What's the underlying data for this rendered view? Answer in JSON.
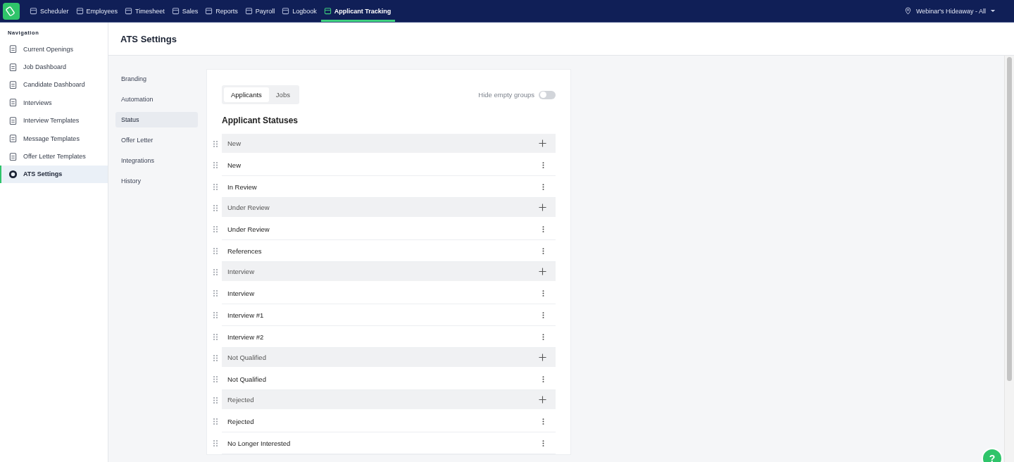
{
  "topbar": {
    "nav": [
      {
        "label": "Scheduler",
        "selected": false
      },
      {
        "label": "Employees",
        "selected": false
      },
      {
        "label": "Timesheet",
        "selected": false
      },
      {
        "label": "Sales",
        "selected": false
      },
      {
        "label": "Reports",
        "selected": false
      },
      {
        "label": "Payroll",
        "selected": false
      },
      {
        "label": "Logbook",
        "selected": false
      },
      {
        "label": "Applicant Tracking",
        "selected": true
      }
    ],
    "location": "Webinar's Hideaway - All"
  },
  "sidebar": {
    "heading": "Navigation",
    "items": [
      {
        "label": "Current Openings",
        "selected": false
      },
      {
        "label": "Job Dashboard",
        "selected": false
      },
      {
        "label": "Candidate Dashboard",
        "selected": false
      },
      {
        "label": "Interviews",
        "selected": false
      },
      {
        "label": "Interview Templates",
        "selected": false
      },
      {
        "label": "Message Templates",
        "selected": false
      },
      {
        "label": "Offer Letter Templates",
        "selected": false
      },
      {
        "label": "ATS Settings",
        "selected": true
      }
    ]
  },
  "page": {
    "title": "ATS Settings",
    "settings_nav": [
      {
        "label": "Branding",
        "selected": false
      },
      {
        "label": "Automation",
        "selected": false
      },
      {
        "label": "Status",
        "selected": true
      },
      {
        "label": "Offer Letter",
        "selected": false
      },
      {
        "label": "Integrations",
        "selected": false
      },
      {
        "label": "History",
        "selected": false
      }
    ],
    "tabs": [
      {
        "label": "Applicants",
        "selected": true
      },
      {
        "label": "Jobs",
        "selected": false
      }
    ],
    "hide_empty_groups": {
      "label": "Hide empty groups",
      "on": false
    },
    "section_title": "Applicant Statuses",
    "rows": [
      {
        "kind": "group",
        "label": "New"
      },
      {
        "kind": "status",
        "label": "New"
      },
      {
        "kind": "status",
        "label": "In Review"
      },
      {
        "kind": "group",
        "label": "Under Review"
      },
      {
        "kind": "status",
        "label": "Under Review"
      },
      {
        "kind": "status",
        "label": "References"
      },
      {
        "kind": "group",
        "label": "Interview"
      },
      {
        "kind": "status",
        "label": "Interview"
      },
      {
        "kind": "status",
        "label": "Interview #1"
      },
      {
        "kind": "status",
        "label": "Interview #2"
      },
      {
        "kind": "group",
        "label": "Not Qualified"
      },
      {
        "kind": "status",
        "label": "Not Qualified"
      },
      {
        "kind": "group",
        "label": "Rejected"
      },
      {
        "kind": "status",
        "label": "Rejected"
      },
      {
        "kind": "status",
        "label": "No Longer Interested"
      }
    ]
  },
  "help": "?"
}
